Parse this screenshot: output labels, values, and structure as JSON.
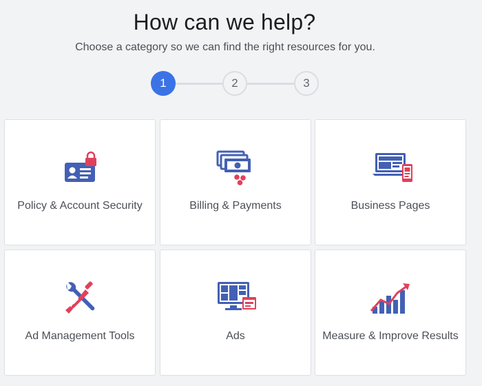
{
  "header": {
    "title": "How can we help?",
    "subtitle": "Choose a category so we can find the right resources for you."
  },
  "stepper": {
    "steps": [
      "1",
      "2",
      "3"
    ],
    "active_step": "1"
  },
  "categories": [
    {
      "label": "Policy & Account Security",
      "icon": "id-card-lock-icon"
    },
    {
      "label": "Billing & Payments",
      "icon": "billing-cards-icon"
    },
    {
      "label": "Business Pages",
      "icon": "business-pages-devices-icon"
    },
    {
      "label": "Ad Management Tools",
      "icon": "wrench-screwdriver-icon"
    },
    {
      "label": "Ads",
      "icon": "ads-monitor-icon"
    },
    {
      "label": "Measure & Improve Results",
      "icon": "growth-chart-icon"
    }
  ],
  "colors": {
    "accent_blue": "#3b73e6",
    "icon_blue": "#4360b4",
    "icon_red": "#e0415a",
    "background": "#f2f3f5",
    "card_border": "#dddfe2"
  }
}
